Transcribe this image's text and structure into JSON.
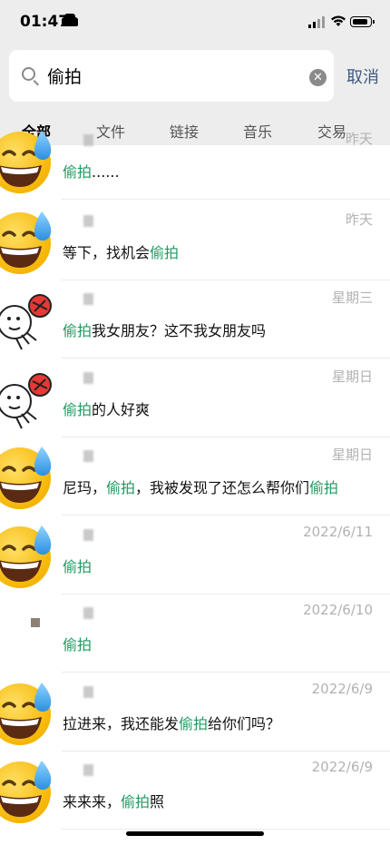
{
  "status_bar": {
    "time": "01:47"
  },
  "search": {
    "query": "偷拍",
    "cancel_label": "取消"
  },
  "tabs": [
    {
      "label": "全部"
    },
    {
      "label": "文件"
    },
    {
      "label": "链接"
    },
    {
      "label": "音乐"
    },
    {
      "label": "交易"
    }
  ],
  "results": [
    {
      "time": "昨天",
      "before": "",
      "keyword": "偷拍",
      "after": "......",
      "after2": "",
      "keyword2": "",
      "avatar": "sweat-smile"
    },
    {
      "time": "昨天",
      "before": "等下，找机会",
      "keyword": "偷拍",
      "after": "",
      "after2": "",
      "keyword2": "",
      "avatar": "sweat-smile"
    },
    {
      "time": "星期三",
      "before": "",
      "keyword": "偷拍",
      "after": "我女朋友？这不我女朋友吗",
      "after2": "",
      "keyword2": "",
      "avatar": "sticker"
    },
    {
      "time": "星期日",
      "before": "",
      "keyword": "偷拍",
      "after": "的人好爽",
      "after2": "",
      "keyword2": "",
      "avatar": "sticker"
    },
    {
      "time": "星期日",
      "before": "尼玛，",
      "keyword": "偷拍",
      "after": "，我被发现了还怎么帮你们",
      "keyword2": "偷拍",
      "after2": "",
      "avatar": "sweat-smile"
    },
    {
      "time": "2022/6/11",
      "before": "",
      "keyword": "偷拍",
      "after": "",
      "after2": "",
      "keyword2": "",
      "avatar": "sweat-smile"
    },
    {
      "time": "2022/6/10",
      "before": "",
      "keyword": "偷拍",
      "after": "",
      "after2": "",
      "keyword2": "",
      "avatar": "blank"
    },
    {
      "time": "2022/6/9",
      "before": "拉进来，我还能发",
      "keyword": "偷拍",
      "after": "给你们吗？",
      "after2": "",
      "keyword2": "",
      "avatar": "sweat-smile"
    },
    {
      "time": "2022/6/9",
      "before": "来来来，",
      "keyword": "偷拍",
      "after": "照",
      "after2": "",
      "keyword2": "",
      "avatar": "sweat-smile"
    }
  ]
}
